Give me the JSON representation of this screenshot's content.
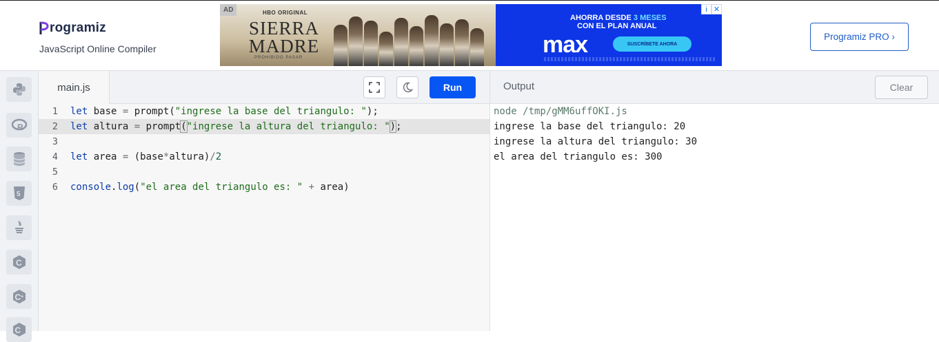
{
  "header": {
    "logo_text": "rogramiz",
    "subtitle": "JavaScript Online Compiler",
    "pro_button": "Programiz PRO ›",
    "ad": {
      "badge": "AD",
      "brand": "HBO ORIGINAL",
      "show_title_line1": "SIERRA",
      "show_title_line2": "MADRE",
      "tagline": "PROHIBIDO PASAR",
      "offer_prefix": "AHORRA DESDE ",
      "offer_highlight": "3 MESES",
      "offer_line2": "CON EL PLAN ANUAL",
      "service": "max",
      "cta": "SUSCRÍBETE AHORA"
    }
  },
  "sidebar": {
    "items": [
      {
        "name": "python-icon"
      },
      {
        "name": "r-icon"
      },
      {
        "name": "sql-icon"
      },
      {
        "name": "html5-icon"
      },
      {
        "name": "java-icon"
      },
      {
        "name": "c-icon"
      },
      {
        "name": "cpp-icon"
      },
      {
        "name": "csharp-icon"
      }
    ]
  },
  "editor": {
    "file_tab": "main.js",
    "run_label": "Run",
    "fullscreen_icon": "fullscreen-icon",
    "theme_icon": "moon-icon",
    "active_line": 2,
    "line_numbers": [
      "1",
      "2",
      "3",
      "4",
      "5",
      "6"
    ]
  },
  "output": {
    "title": "Output",
    "clear_label": "Clear",
    "lines": [
      "node /tmp/gMM6uffOKI.js",
      "ingrese la base del triangulo: 20",
      "ingrese la altura del triangulo: 30",
      "el area del triangulo es: 300"
    ]
  },
  "colors": {
    "accent": "#0556f3",
    "keyword": "#0d3dab",
    "string": "#1f6d1c"
  }
}
